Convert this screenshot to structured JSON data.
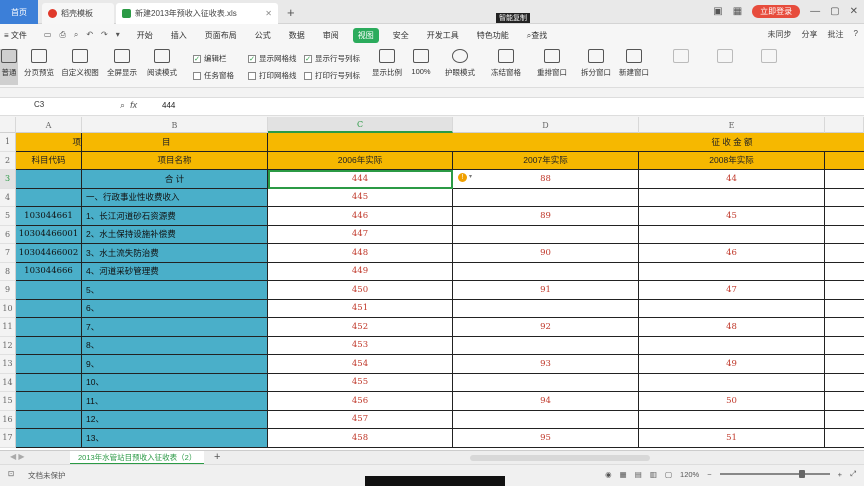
{
  "titlebar": {
    "home_tab": "首页",
    "template_tab": "稻壳模板",
    "file_tab": "新建2013年预收入征收表.xls",
    "login": "立即登录"
  },
  "menu": {
    "file": "文件",
    "items": [
      "开始",
      "插入",
      "页面布局",
      "公式",
      "数据",
      "审阅",
      "视图",
      "安全",
      "开发工具",
      "特色功能"
    ],
    "active": "视图",
    "search": "查找",
    "right": [
      "未同步",
      "分享",
      "批注",
      "?"
    ]
  },
  "ribbon": {
    "normal": "普通",
    "page_break_preview": "分页预览",
    "custom_view": "自定义视图",
    "full_screen": "全屏显示",
    "reading_mode": "阅读模式",
    "cb_edit_bar": "编辑栏",
    "cb_task_pane": "任务窗格",
    "cb_show_gridlines": "显示网格线",
    "cb_print_gridlines": "打印网格线",
    "cb_show_headers": "显示行号列标",
    "cb_print_headers": "打印行号列标",
    "zoom": "显示比例",
    "zoom_100": "100%",
    "eye_mode": "护眼模式",
    "freeze": "冻结窗格",
    "rearrange": "重排窗口",
    "split": "拆分窗口",
    "new_window": "新建窗口"
  },
  "formula_bar": {
    "name_box": "C3",
    "fx": "fx",
    "formula": "444"
  },
  "columns": [
    "A",
    "B",
    "C",
    "D",
    "E"
  ],
  "selected_column": "C",
  "selected_row": "3",
  "header_row1": {
    "row": "1",
    "A": "项",
    "B": "目",
    "E": "征    收    金    额"
  },
  "header_row2": {
    "row": "2",
    "A": "科目代码",
    "B": "项目名称",
    "C": "2006年实际",
    "D": "2007年实际",
    "E": "2008年实际"
  },
  "rows": [
    {
      "n": "3",
      "code": "",
      "name": "合    计",
      "c": "444",
      "d": "88",
      "e": "44"
    },
    {
      "n": "4",
      "code": "",
      "name": "一、行政事业性收费收入",
      "c": "445",
      "d": "",
      "e": ""
    },
    {
      "n": "5",
      "code": "103044661",
      "name": "1、长江河道砂石资源费",
      "c": "446",
      "d": "89",
      "e": "45"
    },
    {
      "n": "6",
      "code": "10304466001",
      "name": "2、水土保持设施补偿费",
      "c": "447",
      "d": "",
      "e": ""
    },
    {
      "n": "7",
      "code": "10304466002",
      "name": "3、水土流失防治费",
      "c": "448",
      "d": "90",
      "e": "46"
    },
    {
      "n": "8",
      "code": "103044666",
      "name": "4、河道采砂管理费",
      "c": "449",
      "d": "",
      "e": ""
    },
    {
      "n": "9",
      "code": "",
      "name": "5、",
      "c": "450",
      "d": "91",
      "e": "47"
    },
    {
      "n": "10",
      "code": "",
      "name": "6、",
      "c": "451",
      "d": "",
      "e": ""
    },
    {
      "n": "11",
      "code": "",
      "name": "7、",
      "c": "452",
      "d": "92",
      "e": "48"
    },
    {
      "n": "12",
      "code": "",
      "name": "8、",
      "c": "453",
      "d": "",
      "e": ""
    },
    {
      "n": "13",
      "code": "",
      "name": "9、",
      "c": "454",
      "d": "93",
      "e": "49"
    },
    {
      "n": "14",
      "code": "",
      "name": "10、",
      "c": "455",
      "d": "",
      "e": ""
    },
    {
      "n": "15",
      "code": "",
      "name": "11、",
      "c": "456",
      "d": "94",
      "e": "50"
    },
    {
      "n": "16",
      "code": "",
      "name": "12、",
      "c": "457",
      "d": "",
      "e": ""
    },
    {
      "n": "17",
      "code": "",
      "name": "13、",
      "c": "458",
      "d": "95",
      "e": "51"
    }
  ],
  "sheet_tab": "2013年水管站目预收入征收表（2）",
  "status": {
    "left": "文档未保护",
    "mid": "智能复制",
    "zoom": "120%"
  },
  "colors": {
    "accent_green": "#2bab5c",
    "header_orange": "#f6b800",
    "teal": "#4aafc9",
    "number_red": "#c0392b"
  }
}
